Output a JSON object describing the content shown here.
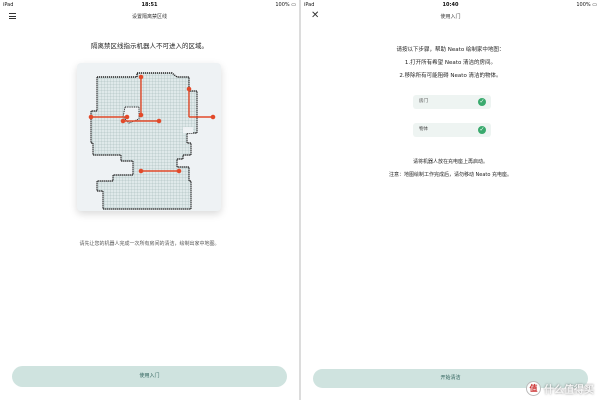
{
  "left": {
    "status": {
      "device": "iPad",
      "time": "18:51",
      "battery": "100%"
    },
    "nav_title": "设置隔离禁区线",
    "heading": "隔离禁区线指示机器人不可进入的区域。",
    "hint": "请先让您的机器人完成一次所有房间的清洁，绘制出家中地图。",
    "button": "使用入门"
  },
  "right": {
    "status": {
      "device": "iPad",
      "time": "10:40",
      "battery": "100%"
    },
    "nav_title": "使用入门",
    "instructions": [
      "请按以下步骤，帮助 Neato 绘制家中地图：",
      "1.打开所有希望 Neato 清洁的房间。",
      "2.移除所有可能阻碍 Neato 清洁的物体。"
    ],
    "checks": [
      {
        "label": "房门"
      },
      {
        "label": "物体"
      }
    ],
    "notes": [
      "请将机器人放在充电座上再启动。",
      "注意：地图绘制工作完成后，请勿移动 Neato 充电座。"
    ],
    "button": "开始清洁"
  },
  "watermark": "什么值得买",
  "colors": {
    "accent": "#cfe3df",
    "check": "#3aaa6e",
    "boundary": "#e24a2a"
  }
}
